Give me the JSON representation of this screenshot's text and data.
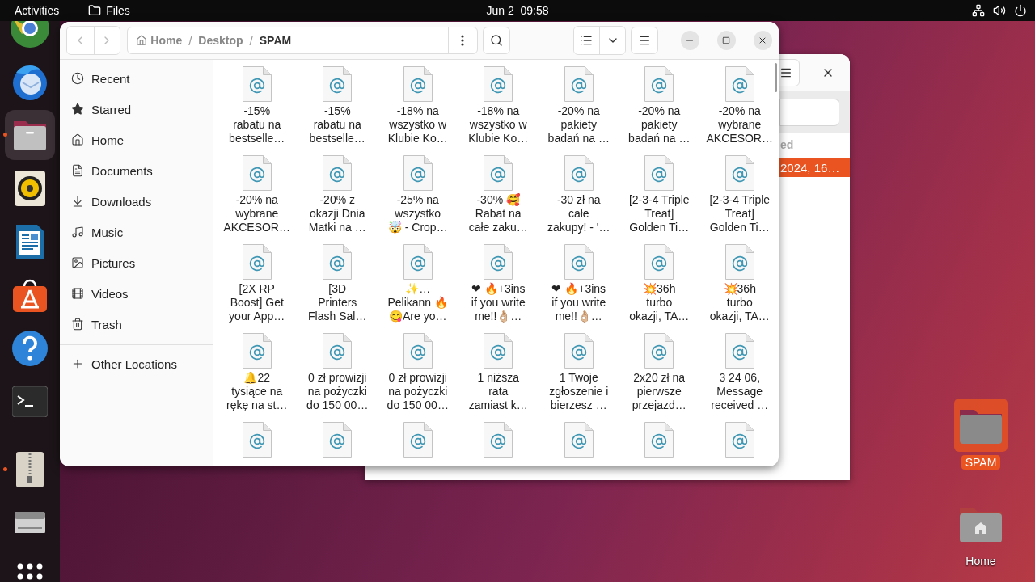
{
  "top_bar": {
    "activities": "Activities",
    "app": "Files",
    "clock": "Jun 2  09:58"
  },
  "dock": [
    {
      "kind": "browser",
      "running": false,
      "selected": false
    },
    {
      "kind": "mail",
      "running": false,
      "selected": false
    },
    {
      "kind": "files",
      "running": true,
      "selected": true
    },
    {
      "kind": "audio",
      "running": false,
      "selected": false
    },
    {
      "kind": "writer",
      "running": false,
      "selected": false
    },
    {
      "kind": "store",
      "running": false,
      "selected": false
    },
    {
      "kind": "help",
      "running": false,
      "selected": false
    },
    {
      "kind": "terminal",
      "running": false,
      "selected": false
    },
    {
      "kind": "archive",
      "running": true,
      "selected": false
    },
    {
      "kind": "drive",
      "running": false,
      "selected": false
    },
    {
      "kind": "grid",
      "running": false,
      "selected": false
    }
  ],
  "back_window": {
    "column_header": "ed",
    "selected_row": "2024, 16…"
  },
  "window": {
    "path_separator": "/",
    "path": [
      {
        "label": "Home",
        "kind": "home",
        "current": false
      },
      {
        "label": "Desktop",
        "kind": "folder",
        "current": false
      },
      {
        "label": "SPAM",
        "kind": "folder",
        "current": true
      }
    ]
  },
  "sidebar": {
    "items": [
      {
        "label": "Recent",
        "kind": "recent",
        "selected": false
      },
      {
        "label": "Starred",
        "kind": "starred",
        "selected": false
      },
      {
        "label": "Home",
        "kind": "home",
        "selected": false
      },
      {
        "label": "Documents",
        "kind": "documents",
        "selected": false
      },
      {
        "label": "Downloads",
        "kind": "downloads",
        "selected": false
      },
      {
        "label": "Music",
        "kind": "music",
        "selected": false
      },
      {
        "label": "Pictures",
        "kind": "pictures",
        "selected": false
      },
      {
        "label": "Videos",
        "kind": "videos",
        "selected": false
      },
      {
        "label": "Trash",
        "kind": "trash",
        "selected": false
      }
    ],
    "other_locations": "Other Locations"
  },
  "files": [
    {
      "name": "-15%\nrabatu na\nbestselle…"
    },
    {
      "name": "-15%\nrabatu na\nbestselle…"
    },
    {
      "name": "-18% na\nwszystko w\nKlubie Ko…"
    },
    {
      "name": "-18% na\nwszystko w\nKlubie Ko…"
    },
    {
      "name": "-20% na\npakiety\nbadań na …"
    },
    {
      "name": "-20% na\npakiety\nbadań na …"
    },
    {
      "name": "-20% na\nwybrane\nAKCESOR…"
    },
    {
      "name": "-20% na\nwybrane\nAKCESOR…"
    },
    {
      "name": "-20% z\nokazji Dnia\nMatki na …"
    },
    {
      "name": "-25% na\nwszystko\n🤯 - Crop…"
    },
    {
      "name": "-30% 🥰\nRabat na\ncałe zaku…"
    },
    {
      "name": "-30 zł na\ncałe\nzakupy! - '…"
    },
    {
      "name": "[2-3-4 Triple\nTreat]\nGolden Ti…"
    },
    {
      "name": "[2-3-4 Triple\nTreat]\nGolden Ti…"
    },
    {
      "name": "[2X RP\nBoost] Get\nyour App…"
    },
    {
      "name": "[3D\nPrinters\nFlash Sal…"
    },
    {
      "name": "✨…\nPelikann 🔥\n😋Are yo…"
    },
    {
      "name": "❤ 🔥+3ins\nif you write\nme!!👌🏼…"
    },
    {
      "name": "❤ 🔥+3ins\nif you write\nme!!👌🏼…"
    },
    {
      "name": "💥36h\nturbo\nokazji, TA…"
    },
    {
      "name": "💥36h\nturbo\nokazji, TA…"
    },
    {
      "name": "🔔22\ntysiące na\nrękę na st…"
    },
    {
      "name": "0 zł prowizji\nna pożyczki\ndo 150 00…"
    },
    {
      "name": "0 zł prowizji\nna pożyczki\ndo 150 00…"
    },
    {
      "name": "1 niższa\nrata\nzamiast k…"
    },
    {
      "name": "1 Twoje\nzgłoszenie i\nbierzesz …"
    },
    {
      "name": "2x20 zł na\npierwsze\nprzejazd…"
    },
    {
      "name": "3 24 06,\nMessage\nreceived …"
    }
  ],
  "desktop_icons": [
    {
      "label": "SPAM",
      "kind": "folder",
      "selected": true
    },
    {
      "label": "Home",
      "kind": "home",
      "selected": false
    }
  ]
}
